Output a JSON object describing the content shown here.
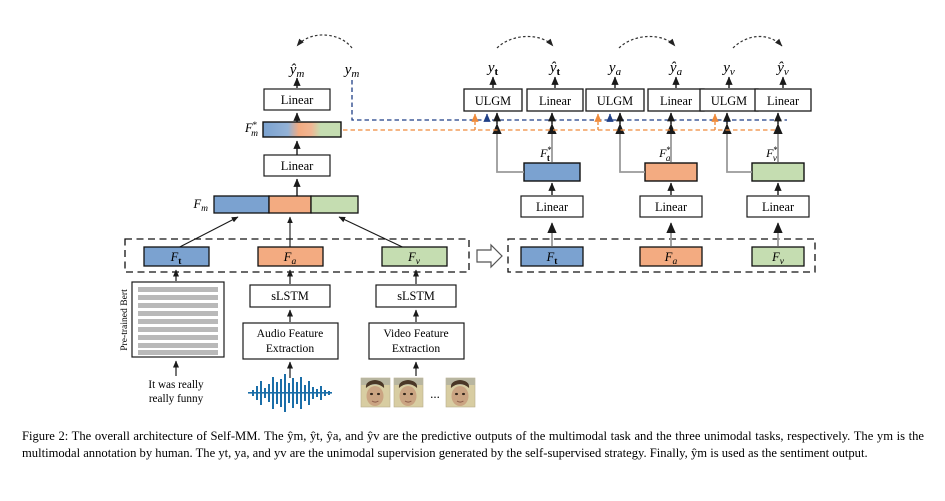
{
  "figure": {
    "label": "Figure 2:",
    "caption_line1": "Figure 2: The overall architecture of Self-MM. The ŷm, ŷt, ŷa, and ŷv are the predictive outputs of the multimodal task and",
    "caption_line2": "the three unimodal tasks, respectively. The ym is the multimodal annotation by human. The yt, ya, and yv are the unimodal",
    "caption_line3": "supervision generated by the self-supervised strategy. Finally, ŷm is used as the sentiment output.",
    "title_text": "The overall architecture of Self-MM."
  },
  "colors": {
    "text_blue": "#7ba2d0",
    "audio_orange": "#f3ab81",
    "video_green": "#c5ddb1",
    "outline": "#1a1a1a",
    "gray_line": "#9a9a9a",
    "orange_dash": "#ef8b3c",
    "navy_dash": "#1f3f86",
    "waveform": "#1b6ea8",
    "bert_stripe": "#b9b9b9",
    "face_skin": "#cbb08a"
  },
  "multimodal_branch": {
    "pred_label": "ŷm",
    "truth_label": "ym",
    "linear_top": "Linear",
    "linear_bottom": "Linear",
    "fusion_star_label": "F*m",
    "fusion_label": "Fm"
  },
  "unimodal_branches": [
    {
      "id": "text",
      "ulgm_label": "ULGM",
      "linear_out_label": "Linear",
      "truth_label": "yt",
      "pred_label": "ŷt",
      "feature_star_label": "F*t",
      "linear_label": "Linear",
      "feature_label": "Ft",
      "color": "#7ba2d0"
    },
    {
      "id": "audio",
      "ulgm_label": "ULGM",
      "linear_out_label": "Linear",
      "truth_label": "ya",
      "pred_label": "ŷa",
      "feature_star_label": "F*a",
      "linear_label": "Linear",
      "feature_label": "Fa",
      "color": "#f3ab81"
    },
    {
      "id": "video",
      "ulgm_label": "ULGM",
      "linear_out_label": "Linear",
      "truth_label": "yv",
      "pred_label": "ŷv",
      "feature_star_label": "F*v",
      "linear_label": "Linear",
      "feature_label": "Fv",
      "color": "#c5ddb1"
    }
  ],
  "encoders": {
    "text": {
      "feature_label": "Ft",
      "encoder_label": "Pre-trained Bert",
      "input_line1": "It was really",
      "input_line2": "really funny"
    },
    "audio": {
      "feature_label": "Fa",
      "encoder_label": "sLSTM",
      "extractor_line1": "Audio Feature",
      "extractor_line2": "Extraction",
      "input_icon": "audio-waveform"
    },
    "video": {
      "feature_label": "Fv",
      "encoder_label": "sLSTM",
      "extractor_line1": "Video Feature",
      "extractor_line2": "Extraction",
      "input_icon": "video-frames",
      "frames_ellipsis": "..."
    }
  },
  "flow_arrow_icon": "right-block-arrow"
}
